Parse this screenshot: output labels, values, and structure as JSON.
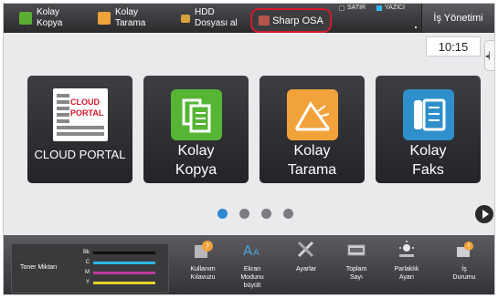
{
  "topbar": {
    "quick_keys": [
      {
        "label": "Kolay\nKopya",
        "icon": "copy-icon"
      },
      {
        "label": "Kolay\nTarama",
        "icon": "scan-icon"
      },
      {
        "label": "HDD\nDosyası al",
        "icon": "folder-icon"
      }
    ],
    "osa_label": "Sharp OSA",
    "mode_labels": [
      "SATIR",
      "YAZICI"
    ],
    "job_status_label": "İş Yönetimi"
  },
  "clock": "10:15",
  "home": {
    "tiles": [
      {
        "label": "CLOUD PORTAL",
        "icon": "cloud-portal-logo",
        "logo_text": [
          "CLOUD",
          "PORTAL"
        ]
      },
      {
        "label": "Kolay\nKopya",
        "icon": "copy-icon"
      },
      {
        "label": "Kolay\nTarama",
        "icon": "scan-icon"
      },
      {
        "label": "Kolay\nFaks",
        "icon": "fax-icon"
      }
    ],
    "pages": 4,
    "active_page": 1
  },
  "bottombar": {
    "toner": {
      "title": "Toner Miktarı",
      "levels": [
        {
          "key": "Bk",
          "color": "#111111"
        },
        {
          "key": "C",
          "color": "#2bb7e6"
        },
        {
          "key": "M",
          "color": "#c03a9a"
        },
        {
          "key": "Y",
          "color": "#e0d22a"
        }
      ]
    },
    "keys": [
      {
        "label": "Kullanım\nKılavuzu",
        "icon": "manual-help-icon"
      },
      {
        "label": "Ekran\nModunu\nbüyült",
        "icon": "enlarge-text-icon"
      },
      {
        "label": "Ayarlar",
        "icon": "settings-tools-icon"
      },
      {
        "label": "Toplam\nSayı",
        "icon": "total-count-icon"
      },
      {
        "label": "Parlaklık\nAyarı",
        "icon": "brightness-icon"
      },
      {
        "label": "İş\nDurumu",
        "icon": "job-status-icon"
      }
    ]
  }
}
